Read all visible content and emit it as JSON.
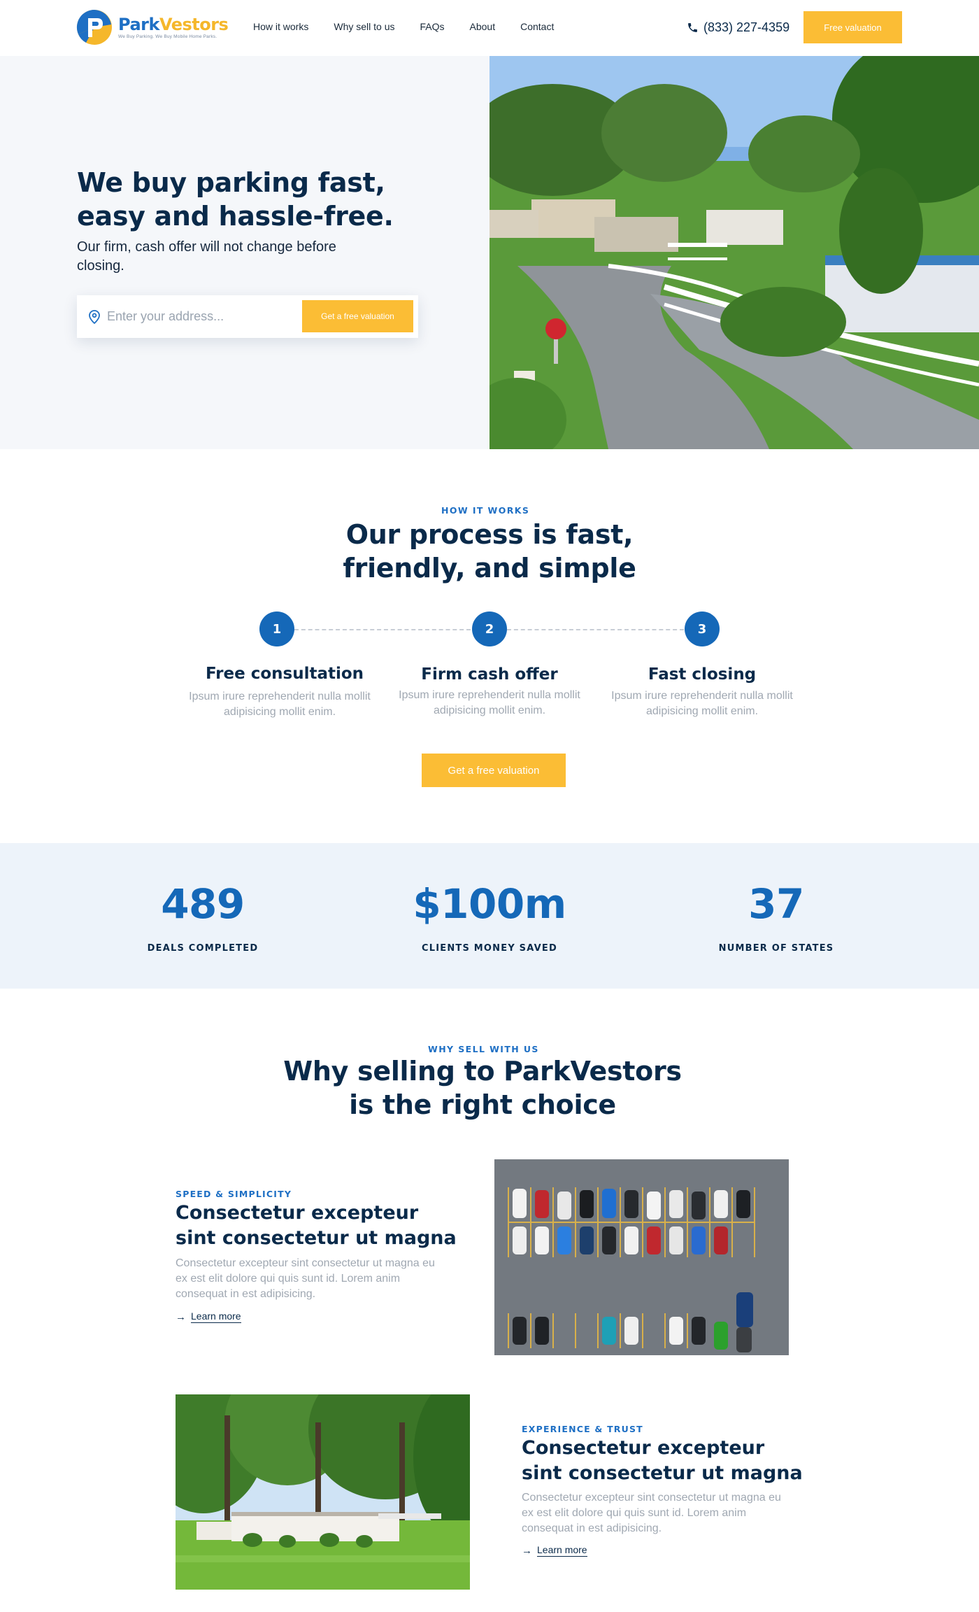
{
  "nav": {
    "logo_name_1": "Park",
    "logo_name_2": "Vestors",
    "logo_tagline": "We Buy Parking. We Buy Mobile Home Parks.",
    "links": [
      "How it works",
      "Why sell to us",
      "FAQs",
      "About",
      "Contact"
    ],
    "phone": "(833) 227-4359",
    "cta": "Free valuation"
  },
  "hero": {
    "title_line1": "We buy parking fast,",
    "title_line2": "easy and hassle-free.",
    "subtitle": "Our firm, cash offer will not change before closing.",
    "address_placeholder": "Enter your address...",
    "form_button": "Get a free valuation"
  },
  "process": {
    "eyebrow": "How it works",
    "title_line1": "Our process is fast,",
    "title_line2": "friendly, and simple",
    "steps": [
      {
        "number": "1",
        "title": "Free consultation",
        "text": "Ipsum irure reprehenderit nulla mollit adipisicing mollit enim."
      },
      {
        "number": "2",
        "title": "Firm cash offer",
        "text": "Ipsum irure reprehenderit nulla mollit adipisicing mollit enim."
      },
      {
        "number": "3",
        "title": "Fast closing",
        "text": "Ipsum irure reprehenderit nulla mollit adipisicing mollit enim."
      }
    ],
    "cta": "Get a free valuation"
  },
  "stats": [
    {
      "value": "489",
      "label": "Deals completed"
    },
    {
      "value": "$100m",
      "label": "Clients money saved"
    },
    {
      "value": "37",
      "label": "Number of states"
    }
  ],
  "why": {
    "eyebrow": "Why sell with us",
    "title_line1": "Why selling to ParkVestors",
    "title_line2": "is the right choice",
    "features": [
      {
        "eyebrow": "Speed & simplicity",
        "title_line1": "Consectetur excepteur",
        "title_line2": "sint consectetur ut magna",
        "text": "Consectetur excepteur sint consectetur ut magna eu ex est elit dolore qui quis sunt id. Lorem anim consequat in est adipisicing.",
        "link": "Learn more"
      },
      {
        "eyebrow": "Experience & trust",
        "title_line1": "Consectetur excepteur",
        "title_line2": "sint consectetur ut magna",
        "text": "Consectetur excepteur sint consectetur ut magna eu ex est elit dolore qui quis sunt id. Lorem anim consequat in est adipisicing.",
        "link": "Learn more"
      }
    ]
  },
  "colors": {
    "brand_blue": "#1568b8",
    "accent_yellow": "#fbbd35",
    "navy_text": "#0a2a4a",
    "stats_bg": "#edf3fa",
    "hero_bg": "#f5f7fa"
  }
}
